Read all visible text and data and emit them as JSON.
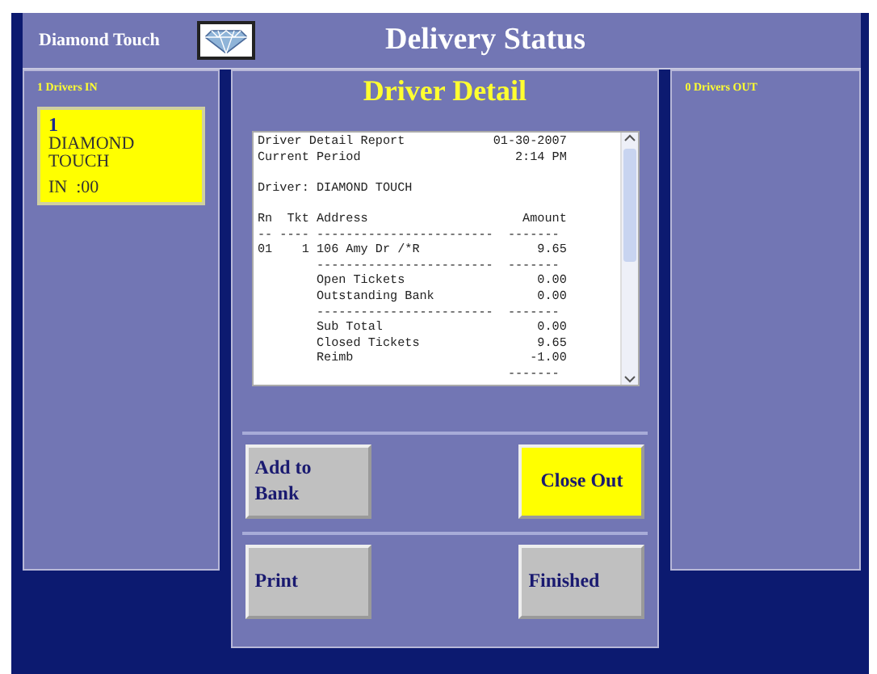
{
  "header": {
    "brand": "Diamond Touch",
    "title": "Delivery Status"
  },
  "drivers_in": {
    "heading": "1 Drivers IN",
    "drivers": [
      {
        "number": "1",
        "name": "DIAMOND TOUCH",
        "status": "IN  :00",
        "selected": true
      }
    ]
  },
  "drivers_out": {
    "heading": "0 Drivers OUT"
  },
  "detail": {
    "title": "Driver Detail",
    "report_lines": [
      {
        "text": "Driver Detail Report            01-30-2007",
        "blank_before": false
      },
      {
        "text": "Current Period                     2:14 PM",
        "blank_before": false
      },
      {
        "text": "Driver: DIAMOND TOUCH",
        "blank_before": true
      },
      {
        "text": "Rn  Tkt Address                     Amount",
        "blank_before": true
      },
      {
        "text": "-- ---- ------------------------  -------",
        "blank_before": false
      },
      {
        "text": "01    1 106 Amy Dr /*R                9.65",
        "blank_before": false
      },
      {
        "text": "        ------------------------  -------",
        "blank_before": false
      },
      {
        "text": "        Open Tickets                  0.00",
        "blank_before": false
      },
      {
        "text": "        Outstanding Bank              0.00",
        "blank_before": false
      },
      {
        "text": "        ------------------------  -------",
        "blank_before": false
      },
      {
        "text": "        Sub Total                     0.00",
        "blank_before": false
      },
      {
        "text": "        Closed Tickets                9.65",
        "blank_before": false
      },
      {
        "text": "        Reimb                        -1.00",
        "blank_before": false
      },
      {
        "text": "                                  -------",
        "blank_before": false
      }
    ],
    "button_rows": [
      [
        {
          "label": "Add to\nBank",
          "highlighted": false
        },
        {
          "label": "Close Out",
          "highlighted": true
        }
      ],
      [
        {
          "label": "Print",
          "highlighted": false
        },
        {
          "label": "Finished",
          "highlighted": false
        }
      ]
    ]
  }
}
